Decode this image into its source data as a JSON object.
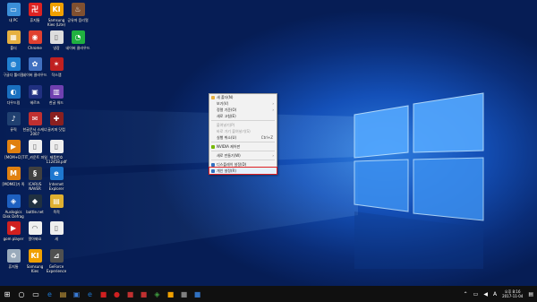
{
  "desktop_icons": [
    {
      "label": "내 PC",
      "color": "#3b8fd8",
      "glyph": "▭",
      "col": 0,
      "row": 0
    },
    {
      "label": "휴지통",
      "color": "#d22",
      "glyph": "卍",
      "col": 1,
      "row": 0
    },
    {
      "label": "Samsung Kies (Lite)",
      "color": "#f0a000",
      "glyph": "KI",
      "col": 2,
      "row": 0
    },
    {
      "label": "공유마 음리얼",
      "color": "#805030",
      "glyph": "♨",
      "col": 3,
      "row": 0
    },
    {
      "label": "폴더",
      "color": "#e6b040",
      "glyph": "▦",
      "col": 0,
      "row": 1
    },
    {
      "label": "Chrome",
      "color": "#e04030",
      "glyph": "◉",
      "col": 1,
      "row": 1
    },
    {
      "label": "냉장",
      "color": "#ddd",
      "glyph": "▯",
      "col": 2,
      "row": 1
    },
    {
      "label": "네이버 클라우드",
      "color": "#20b040",
      "glyph": "◔",
      "col": 3,
      "row": 1
    },
    {
      "label": "구글다 툴리잘",
      "color": "#2080d0",
      "glyph": "◍",
      "col": 0,
      "row": 2
    },
    {
      "label": "네이버 클라우드",
      "color": "#4070c0",
      "glyph": "✿",
      "col": 1,
      "row": 2
    },
    {
      "label": "작스랩",
      "color": "#c02020",
      "glyph": "✶",
      "col": 2,
      "row": 2
    },
    {
      "label": "다우드림",
      "color": "#1a70c0",
      "glyph": "◐",
      "col": 0,
      "row": 3
    },
    {
      "label": "헤르츠",
      "color": "#203080",
      "glyph": "▣",
      "col": 1,
      "row": 3
    },
    {
      "label": "한글 워드",
      "color": "#7040b0",
      "glyph": "▥",
      "col": 2,
      "row": 3
    },
    {
      "label": "뮤직",
      "color": "#204070",
      "glyph": "♪",
      "col": 0,
      "row": 4
    },
    {
      "label": "한글문서 스캐너 2007",
      "color": "#c03030",
      "glyph": "✉",
      "col": 1,
      "row": 4
    },
    {
      "label": "골키퍼 닷컴",
      "color": "#8a2020",
      "glyph": "✚",
      "col": 2,
      "row": 4
    },
    {
      "label": "[MOM+D]",
      "color": "#e08010",
      "glyph": "▶",
      "col": 0,
      "row": 5
    },
    {
      "label": "TIT_카운트 파일",
      "color": "#eee",
      "glyph": "▯",
      "col": 1,
      "row": 5
    },
    {
      "label": "제품번호 112458.pdf",
      "color": "#eee",
      "glyph": "▯",
      "col": 2,
      "row": 5
    },
    {
      "label": "[MOMO]가 족",
      "color": "#e08010",
      "glyph": "M",
      "col": 0,
      "row": 6
    },
    {
      "label": "ICARUS NAVER",
      "color": "#404040",
      "glyph": "§",
      "col": 1,
      "row": 6
    },
    {
      "label": "Internet Explorer",
      "color": "#1e78d0",
      "glyph": "e",
      "col": 2,
      "row": 6
    },
    {
      "label": "Auslogics Disk Defrag",
      "color": "#1e60c0",
      "glyph": "◈",
      "col": 0,
      "row": 7
    },
    {
      "label": "battle.net",
      "color": "#203040",
      "glyph": "◆",
      "col": 1,
      "row": 7
    },
    {
      "label": "목적",
      "color": "#e0b030",
      "glyph": "▤",
      "col": 2,
      "row": 7
    },
    {
      "label": "gom player",
      "color": "#d02020",
      "glyph": "▶",
      "col": 0,
      "row": 8
    },
    {
      "label": "알아봐요",
      "color": "#f0f0f0",
      "glyph": "◠",
      "col": 1,
      "row": 8
    },
    {
      "label": "새",
      "color": "#eee",
      "glyph": "▯",
      "col": 2,
      "row": 8
    },
    {
      "label": "휴지통",
      "color": "#9ab",
      "glyph": "♻",
      "col": 0,
      "row": 9
    },
    {
      "label": "Samsung Kies",
      "color": "#f0a000",
      "glyph": "KI",
      "col": 1,
      "row": 9
    },
    {
      "label": "GeForce Experience",
      "color": "#505050",
      "glyph": "⊿",
      "col": 2,
      "row": 9
    }
  ],
  "context_menu": {
    "items": [
      {
        "label": "새 폴더(N)",
        "type": "item",
        "icon_color": "#e6b040"
      },
      {
        "label": "보기(V)",
        "type": "item",
        "arrow": "›"
      },
      {
        "label": "정렬 기준(O)",
        "type": "item",
        "arrow": "›"
      },
      {
        "label": "새로 고침(E)",
        "type": "item"
      },
      {
        "type": "sep"
      },
      {
        "label": "붙여넣기(P)",
        "type": "dis"
      },
      {
        "label": "바로 가기 붙여넣기(S)",
        "type": "dis"
      },
      {
        "label": "실행 취소(U)",
        "type": "item",
        "shortcut": "Ctrl+Z"
      },
      {
        "type": "sep"
      },
      {
        "label": "NVIDIA 제어판",
        "type": "item",
        "icon_color": "#76b900"
      },
      {
        "type": "sep"
      },
      {
        "label": "새로 만들기(W)",
        "type": "item",
        "arrow": "›"
      },
      {
        "type": "sep"
      },
      {
        "label": "디스플레이 설정(D)",
        "type": "item",
        "icon_color": "#3070c0"
      },
      {
        "label": "개인 설정(R)",
        "type": "item",
        "icon_color": "#3070c0",
        "highlight": true
      }
    ]
  },
  "taskbar": {
    "pinned": [
      {
        "name": "start",
        "color": "#ffffff",
        "glyph": "⊞"
      },
      {
        "name": "search",
        "color": "#ffffff",
        "glyph": "○"
      },
      {
        "name": "task-view",
        "color": "#ffffff",
        "glyph": "▭"
      },
      {
        "name": "edge",
        "color": "#1e78d0",
        "glyph": "e"
      },
      {
        "name": "explorer",
        "color": "#e6b040",
        "glyph": "▤"
      },
      {
        "name": "store",
        "color": "#3a7bd5",
        "glyph": "▣"
      },
      {
        "name": "ie",
        "color": "#1e78d0",
        "glyph": "e"
      },
      {
        "name": "app1",
        "color": "#d02020",
        "glyph": "■"
      },
      {
        "name": "app2",
        "color": "#d02020",
        "glyph": "●"
      },
      {
        "name": "app3",
        "color": "#c03030",
        "glyph": "■"
      },
      {
        "name": "app4",
        "color": "#c03030",
        "glyph": "■"
      },
      {
        "name": "app5",
        "color": "#40a040",
        "glyph": "◈"
      },
      {
        "name": "app6",
        "color": "#f0a000",
        "glyph": "■"
      },
      {
        "name": "app7",
        "color": "#808080",
        "glyph": "■"
      },
      {
        "name": "app8",
        "color": "#3070c0",
        "glyph": "■"
      }
    ],
    "tray_text": "A",
    "clock_time": "오후 8:16",
    "clock_date": "2017-11-04"
  }
}
